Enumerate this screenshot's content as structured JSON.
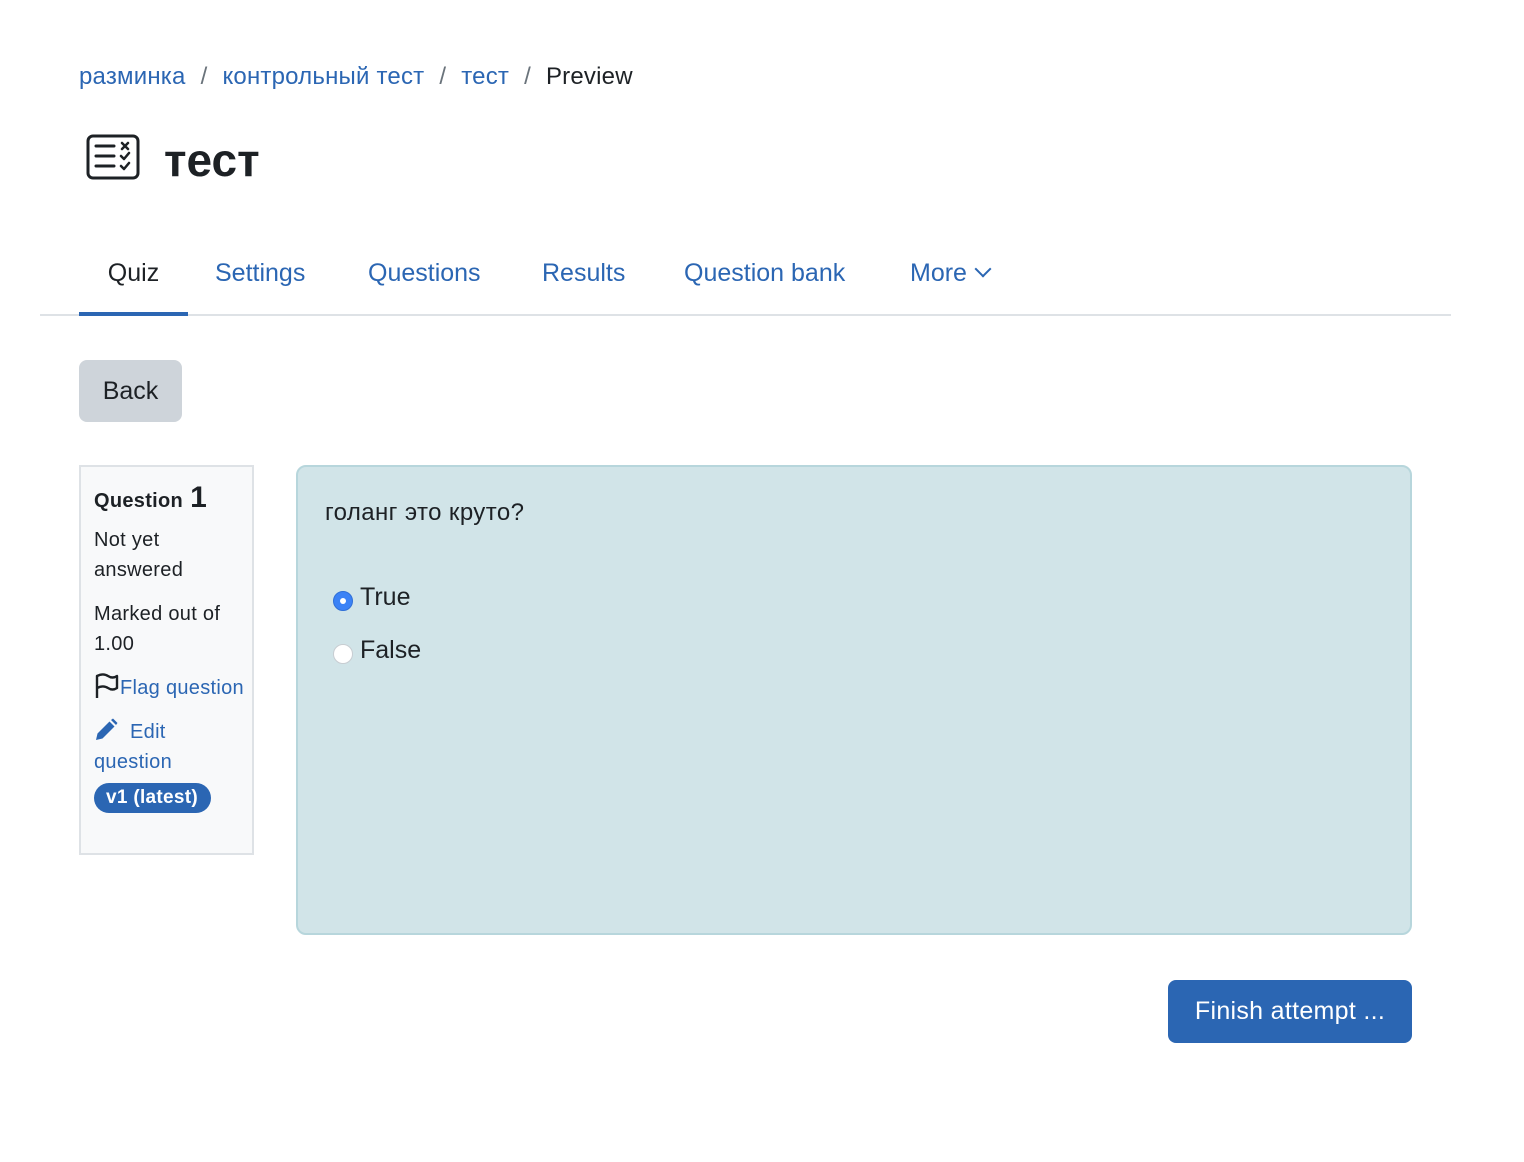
{
  "breadcrumb": {
    "items": [
      "разминка",
      "контрольный тест",
      "тест"
    ],
    "current": "Preview",
    "separator": "/"
  },
  "page": {
    "title": "тест",
    "icon": "quiz-icon"
  },
  "tabs": [
    {
      "label": "Quiz",
      "active": true
    },
    {
      "label": "Settings",
      "active": false
    },
    {
      "label": "Questions",
      "active": false
    },
    {
      "label": "Results",
      "active": false
    },
    {
      "label": "Question bank",
      "active": false
    },
    {
      "label": "More",
      "active": false,
      "icon": "chevron-down-icon"
    }
  ],
  "back_button": "Back",
  "question_info": {
    "label": "Question",
    "number": "1",
    "state": "Not yet answered",
    "grade": "Marked out of 1.00",
    "flag": {
      "label": "Flag question",
      "icon": "flag-icon"
    },
    "edit": {
      "label": "Edit question",
      "icon": "pencil-icon"
    },
    "version": "v1 (latest)"
  },
  "question": {
    "text": "голанг это круто?",
    "answers": [
      {
        "label": "True",
        "selected": true
      },
      {
        "label": "False",
        "selected": false
      }
    ]
  },
  "finish_button": "Finish attempt ...",
  "colors": {
    "link": "#2b66b3",
    "content_background": "#d1e4e8",
    "info_background": "#f8f9fa",
    "secondary_button": "#ced4da",
    "primary_button": "#2b66b3"
  }
}
